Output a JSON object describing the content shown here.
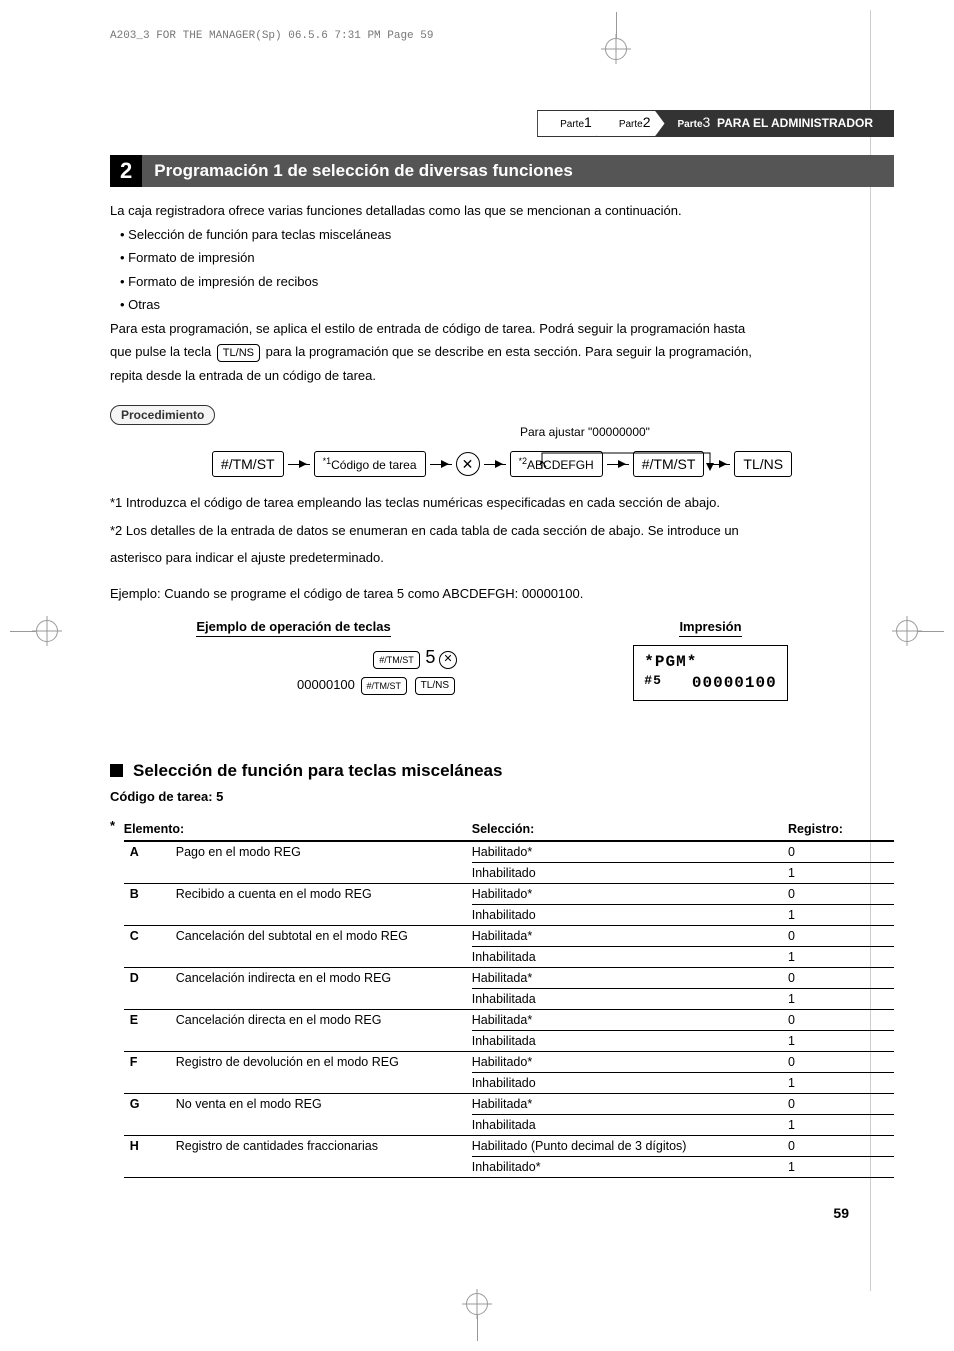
{
  "slug": "A203_3 FOR THE MANAGER(Sp)  06.5.6 7:31 PM  Page 59",
  "breadcrumb": {
    "p1_label": "Parte",
    "p1_num": "1",
    "p2_label": "Parte",
    "p2_num": "2",
    "p3_label": "Parte",
    "p3_num": "3",
    "p3_title": "PARA EL ADMINISTRADOR"
  },
  "section_num": "2",
  "section_title": "Programación 1 de selección de diversas funciones",
  "intro": {
    "l1": "La caja registradora ofrece varias funciones detalladas como las que se mencionan a continuación.",
    "b1": "• Selección de función para teclas misceláneas",
    "b2": "• Formato de impresión",
    "b3": "• Formato de impresión de recibos",
    "b4": "• Otras",
    "l2a": "Para esta programación, se aplica el estilo de entrada de código de tarea. Podrá seguir la programación hasta",
    "l2b": "que pulse la tecla ",
    "l2c": " para la programación que se describe en esta sección. Para seguir la programación,",
    "l2d": "repita desde la entrada de un código de tarea.",
    "key_tlns": "TL/NS"
  },
  "procedure_label": "Procedimiento",
  "flow": {
    "preset_label": "Para ajustar \"00000000\"",
    "box1": "#/TM/ST",
    "box2_pre": "*1",
    "box2": "Código de tarea",
    "circle": "✕",
    "box3_pre": "*2",
    "box3": "ABCDEFGH",
    "box4": "#/TM/ST",
    "box5": "TL/NS"
  },
  "notes": {
    "n1": "*1  Introduzca el código de tarea empleando las teclas numéricas especificadas en cada sección de abajo.",
    "n2a": "*2  Los detalles de la entrada de datos se enumeran en cada tabla de cada sección de abajo. Se introduce un",
    "n2b": "asterisco para indicar el ajuste predeterminado."
  },
  "example": {
    "intro": "Ejemplo:   Cuando se programe el código de tarea 5 como ABCDEFGH: 00000100.",
    "col1_header": "Ejemplo de operación de teclas",
    "col2_header": "Impresión",
    "key_tmst": "#/TM/ST",
    "key_5": "5",
    "key_x": "✕",
    "key_num": "00000100",
    "key_tlns": "TL/NS",
    "print_l1": "*PGM*",
    "print_l2a": "#5",
    "print_l2b": "00000100"
  },
  "subsection": {
    "title": "Selección de función para teclas misceláneas",
    "task_code": "Código de tarea: 5",
    "star": "*",
    "th_item": "Elemento:",
    "th_sel": "Selección:",
    "th_reg": "Registro:",
    "rows": [
      {
        "letter": "A",
        "desc": "Pago en el modo REG",
        "sel": "Habilitado*",
        "reg": "0"
      },
      {
        "letter": "",
        "desc": "",
        "sel": "Inhabilitado",
        "reg": "1"
      },
      {
        "letter": "B",
        "desc": "Recibido a cuenta en el modo REG",
        "sel": "Habilitado*",
        "reg": "0"
      },
      {
        "letter": "",
        "desc": "",
        "sel": "Inhabilitado",
        "reg": "1"
      },
      {
        "letter": "C",
        "desc": "Cancelación del subtotal en el modo REG",
        "sel": "Habilitada*",
        "reg": "0"
      },
      {
        "letter": "",
        "desc": "",
        "sel": "Inhabilitada",
        "reg": "1"
      },
      {
        "letter": "D",
        "desc": "Cancelación indirecta en el modo REG",
        "sel": "Habilitada*",
        "reg": "0"
      },
      {
        "letter": "",
        "desc": "",
        "sel": "Inhabilitada",
        "reg": "1"
      },
      {
        "letter": "E",
        "desc": "Cancelación directa en el modo REG",
        "sel": "Habilitada*",
        "reg": "0"
      },
      {
        "letter": "",
        "desc": "",
        "sel": "Inhabilitada",
        "reg": "1"
      },
      {
        "letter": "F",
        "desc": "Registro de devolución en el modo REG",
        "sel": "Habilitado*",
        "reg": "0"
      },
      {
        "letter": "",
        "desc": "",
        "sel": "Inhabilitado",
        "reg": "1"
      },
      {
        "letter": "G",
        "desc": "No venta en el modo REG",
        "sel": "Habilitada*",
        "reg": "0"
      },
      {
        "letter": "",
        "desc": "",
        "sel": "Inhabilitada",
        "reg": "1"
      },
      {
        "letter": "H",
        "desc": "Registro de cantidades fraccionarias",
        "sel": "Habilitado (Punto decimal de 3 dígitos)",
        "reg": "0"
      },
      {
        "letter": "",
        "desc": "",
        "sel": "Inhabilitado*",
        "reg": "1"
      }
    ]
  },
  "page_number": "59"
}
